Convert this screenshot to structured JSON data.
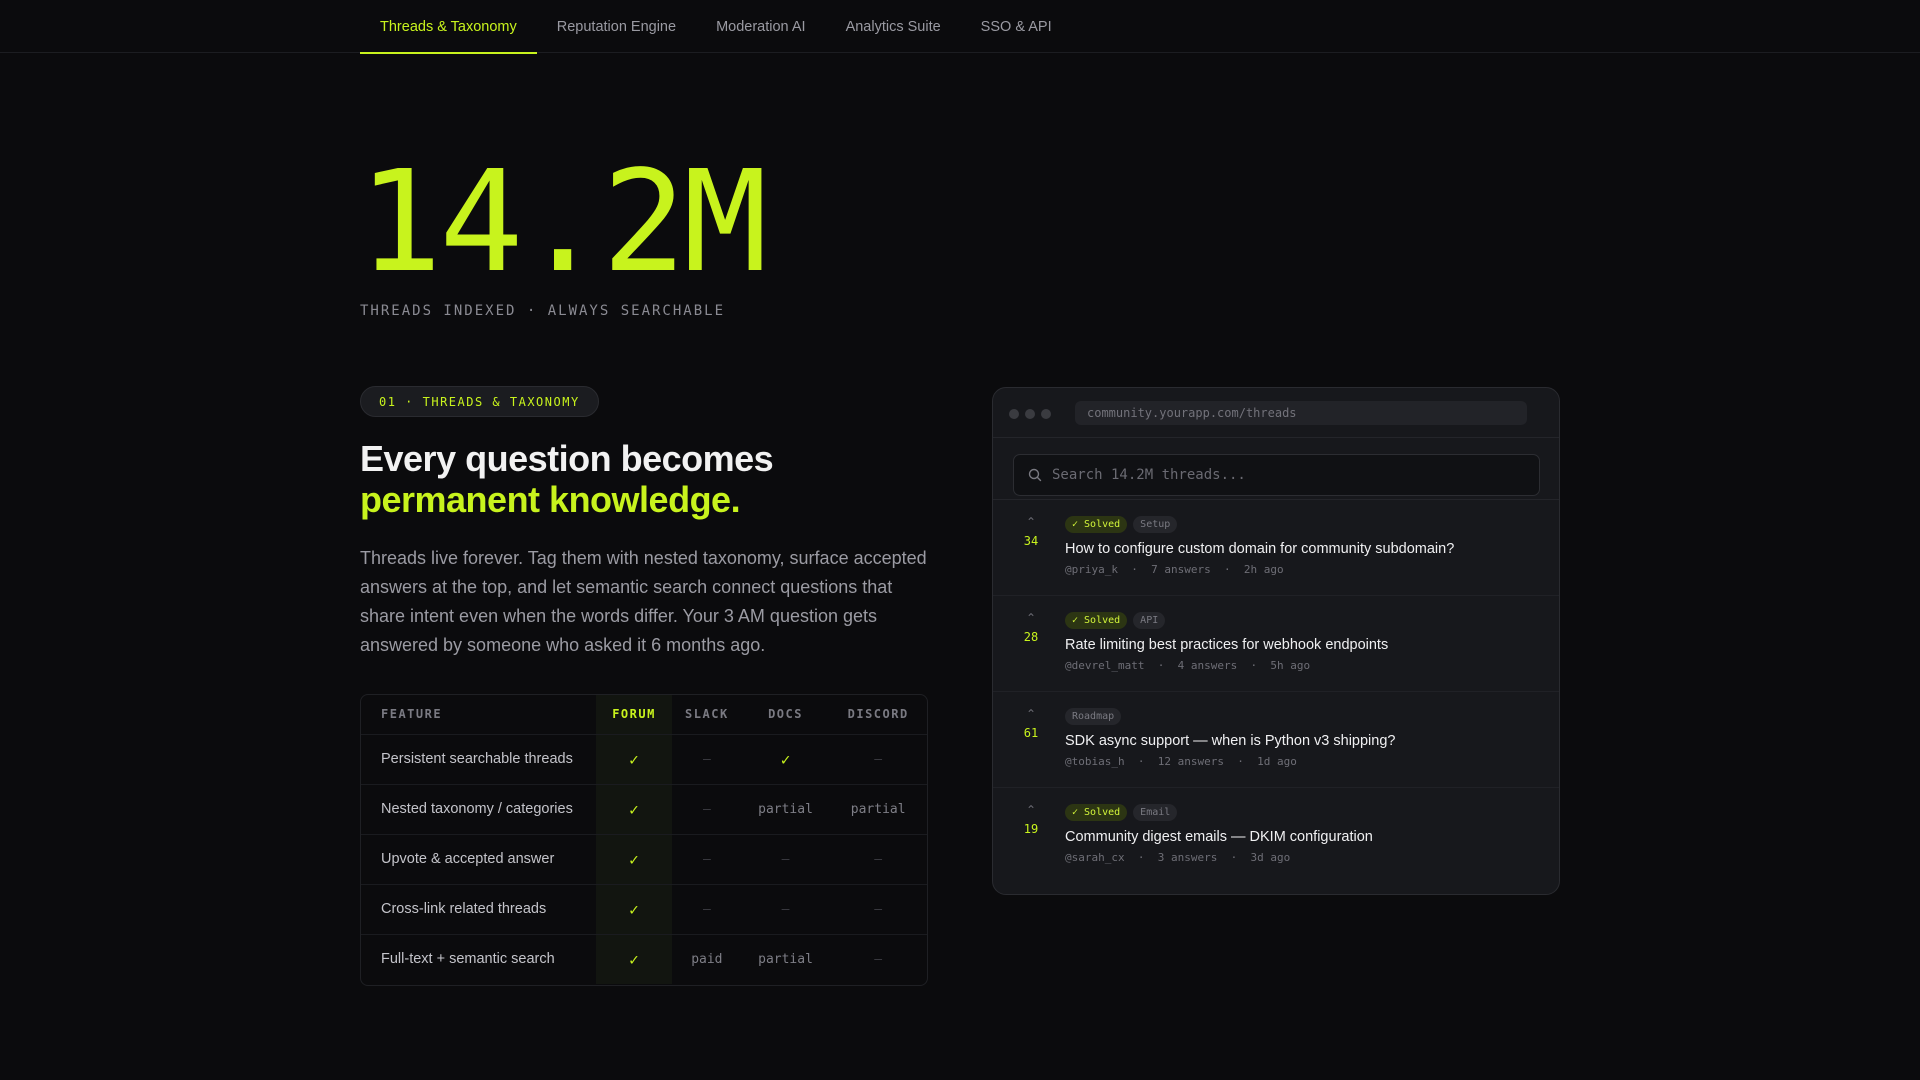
{
  "nav": {
    "tabs": [
      {
        "label": "Threads & Taxonomy",
        "active": true
      },
      {
        "label": "Reputation Engine",
        "active": false
      },
      {
        "label": "Moderation AI",
        "active": false
      },
      {
        "label": "Analytics Suite",
        "active": false
      },
      {
        "label": "SSO & API",
        "active": false
      }
    ]
  },
  "hero": {
    "number": "14.2M",
    "subtitle": "THREADS INDEXED · ALWAYS SEARCHABLE"
  },
  "section": {
    "pill": "01 · THREADS & TAXONOMY",
    "headline_line1": "Every question becomes",
    "headline_line2": "permanent knowledge.",
    "paragraph": "Threads live forever. Tag them with nested taxonomy, surface accepted answers at the top, and let semantic search connect questions that share intent even when the words differ. Your 3 AM question gets answered by someone who asked it 6 months ago."
  },
  "comparison": {
    "headers": [
      "FEATURE",
      "FORUM",
      "SLACK",
      "DOCS",
      "DISCORD"
    ],
    "rows": [
      {
        "feature": "Persistent searchable threads",
        "forum": "✓",
        "slack": "—",
        "docs": "✓",
        "discord": "—"
      },
      {
        "feature": "Nested taxonomy / categories",
        "forum": "✓",
        "slack": "—",
        "docs": "partial",
        "discord": "partial"
      },
      {
        "feature": "Upvote & accepted answer",
        "forum": "✓",
        "slack": "—",
        "docs": "—",
        "discord": "—"
      },
      {
        "feature": "Cross-link related threads",
        "forum": "✓",
        "slack": "—",
        "docs": "—",
        "discord": "—"
      },
      {
        "feature": "Full-text + semantic search",
        "forum": "✓",
        "slack": "paid",
        "docs": "partial",
        "discord": "—"
      }
    ]
  },
  "browser": {
    "url": "community.yourapp.com/threads",
    "search_placeholder": "Search 14.2M threads...",
    "threads": [
      {
        "votes": "34",
        "solved": "✓ Solved",
        "tag": "Setup",
        "title": "How to configure custom domain for community subdomain?",
        "author": "@priya_k",
        "answers": "7 answers",
        "time": "2h ago"
      },
      {
        "votes": "28",
        "solved": "✓ Solved",
        "tag": "API",
        "title": "Rate limiting best practices for webhook endpoints",
        "author": "@devrel_matt",
        "answers": "4 answers",
        "time": "5h ago"
      },
      {
        "votes": "61",
        "solved": "",
        "tag": "Roadmap",
        "title": "SDK async support — when is Python v3 shipping?",
        "author": "@tobias_h",
        "answers": "12 answers",
        "time": "1d ago"
      },
      {
        "votes": "19",
        "solved": "✓ Solved",
        "tag": "Email",
        "title": "Community digest emails — DKIM configuration",
        "author": "@sarah_cx",
        "answers": "3 answers",
        "time": "3d ago"
      }
    ]
  },
  "colors": {
    "accent": "#c8f31d",
    "background": "#0b0b0d",
    "panel": "#17181c"
  }
}
